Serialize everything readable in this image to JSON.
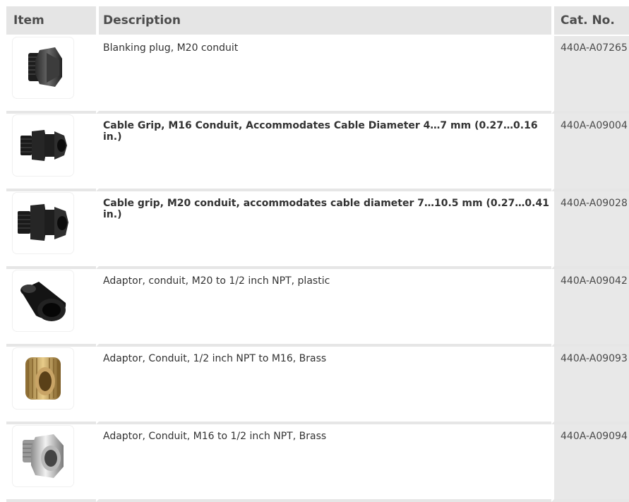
{
  "table": {
    "headers": {
      "item": "Item",
      "description": "Description",
      "cat_no": "Cat. No."
    },
    "rows": [
      {
        "image": "blanking-plug-image",
        "description": "Blanking plug, M20 conduit",
        "cat_no": "440A-A07265"
      },
      {
        "image": "cable-grip-m16-image",
        "description": "Cable Grip, M16 Conduit, Accommodates Cable Diameter 4…7 mm (0.27…0.16 in.)",
        "cat_no": "440A-A09004"
      },
      {
        "image": "cable-grip-m20-image",
        "description": "Cable grip, M20 conduit, accommodates cable diameter 7…10.5 mm (0.27…0.41 in.)",
        "cat_no": "440A-A09028"
      },
      {
        "image": "adaptor-plastic-image",
        "description": "Adaptor, conduit, M20 to 1/2 inch NPT, plastic",
        "cat_no": "440A-A09042"
      },
      {
        "image": "adaptor-brass-image",
        "description": "Adaptor, Conduit, 1/2 inch NPT to M16, Brass",
        "cat_no": "440A-A09093"
      },
      {
        "image": "adaptor-nickel-image",
        "description": "Adaptor, Conduit, M16 to 1/2 inch NPT, Brass",
        "cat_no": "440A-A09094"
      }
    ]
  }
}
